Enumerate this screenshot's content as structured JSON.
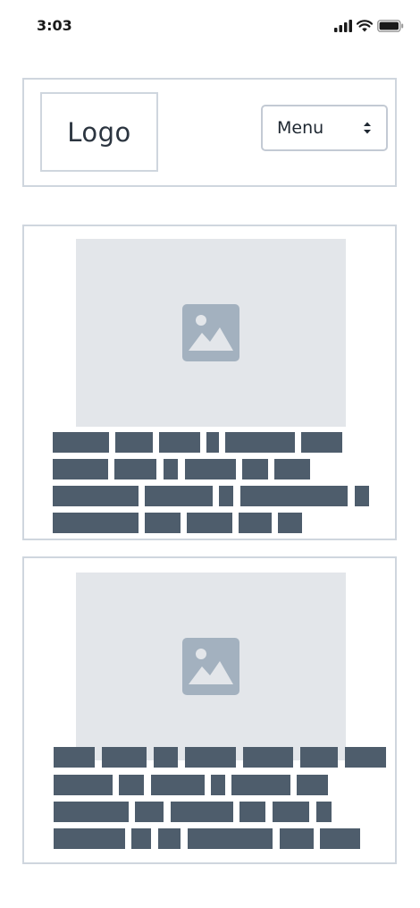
{
  "status_bar": {
    "time": "3:03",
    "icons": [
      "signal-icon",
      "wifi-icon",
      "battery-icon"
    ]
  },
  "header": {
    "logo_text": "Logo",
    "menu_select": {
      "selected": "Menu",
      "icon": "chevron-updown-icon"
    }
  },
  "cards": [
    {
      "image_icon": "image-placeholder-icon",
      "text_lines": 4
    },
    {
      "image_icon": "image-placeholder-icon",
      "text_lines": 4
    }
  ],
  "colors": {
    "border": "#cfd6de",
    "placeholder_bg": "#e3e6ea",
    "placeholder_icon": "#a3b1bf",
    "text_block": "#4e5d6c"
  }
}
